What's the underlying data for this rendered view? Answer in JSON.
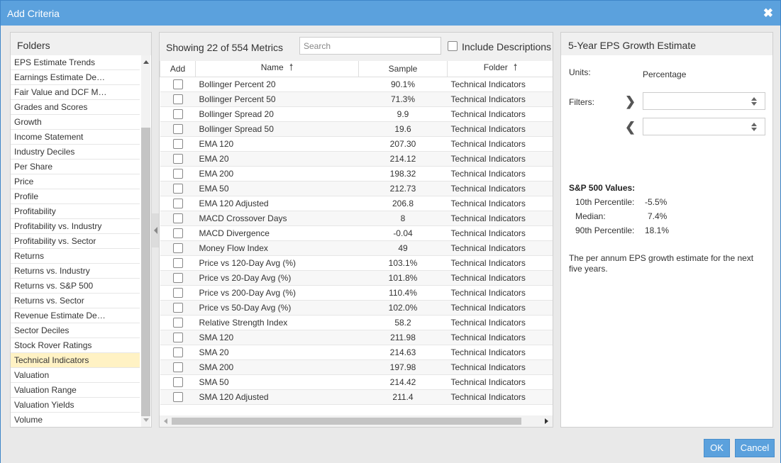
{
  "dialog": {
    "title": "Add Criteria",
    "close_icon": "close-icon"
  },
  "folders": {
    "header": "Folders",
    "items": [
      "EPS Estimate Trends",
      "Earnings Estimate De…",
      "Fair Value and DCF M…",
      "Grades and Scores",
      "Growth",
      "Income Statement",
      "Industry Deciles",
      "Per Share",
      "Price",
      "Profile",
      "Profitability",
      "Profitability vs. Industry",
      "Profitability vs. Sector",
      "Returns",
      "Returns vs. Industry",
      "Returns vs. S&P 500",
      "Returns vs. Sector",
      "Revenue Estimate De…",
      "Sector Deciles",
      "Stock Rover Ratings",
      "Technical Indicators",
      "Valuation",
      "Valuation Range",
      "Valuation Yields",
      "Volume"
    ],
    "selected": "Technical Indicators"
  },
  "metrics": {
    "showing": "Showing 22 of 554 Metrics",
    "search_placeholder": "Search",
    "include_descriptions": "Include Descriptions",
    "columns": {
      "add": "Add",
      "name": "Name",
      "sample": "Sample",
      "folder": "Folder"
    },
    "rows": [
      {
        "name": "Bollinger Percent 20",
        "sample": "90.1%",
        "folder": "Technical Indicators"
      },
      {
        "name": "Bollinger Percent 50",
        "sample": "71.3%",
        "folder": "Technical Indicators"
      },
      {
        "name": "Bollinger Spread 20",
        "sample": "9.9",
        "folder": "Technical Indicators"
      },
      {
        "name": "Bollinger Spread 50",
        "sample": "19.6",
        "folder": "Technical Indicators"
      },
      {
        "name": "EMA 120",
        "sample": "207.30",
        "folder": "Technical Indicators"
      },
      {
        "name": "EMA 20",
        "sample": "214.12",
        "folder": "Technical Indicators"
      },
      {
        "name": "EMA 200",
        "sample": "198.32",
        "folder": "Technical Indicators"
      },
      {
        "name": "EMA 50",
        "sample": "212.73",
        "folder": "Technical Indicators"
      },
      {
        "name": "EMA 120 Adjusted",
        "sample": "206.8",
        "folder": "Technical Indicators"
      },
      {
        "name": "MACD Crossover Days",
        "sample": "8",
        "folder": "Technical Indicators"
      },
      {
        "name": "MACD Divergence",
        "sample": "-0.04",
        "folder": "Technical Indicators"
      },
      {
        "name": "Money Flow Index",
        "sample": "49",
        "folder": "Technical Indicators"
      },
      {
        "name": "Price vs 120-Day Avg (%)",
        "sample": "103.1%",
        "folder": "Technical Indicators"
      },
      {
        "name": "Price vs 20-Day Avg (%)",
        "sample": "101.8%",
        "folder": "Technical Indicators"
      },
      {
        "name": "Price vs 200-Day Avg (%)",
        "sample": "110.4%",
        "folder": "Technical Indicators"
      },
      {
        "name": "Price vs 50-Day Avg (%)",
        "sample": "102.0%",
        "folder": "Technical Indicators"
      },
      {
        "name": "Relative Strength Index",
        "sample": "58.2",
        "folder": "Technical Indicators"
      },
      {
        "name": "SMA 120",
        "sample": "211.98",
        "folder": "Technical Indicators"
      },
      {
        "name": "SMA 20",
        "sample": "214.63",
        "folder": "Technical Indicators"
      },
      {
        "name": "SMA 200",
        "sample": "197.98",
        "folder": "Technical Indicators"
      },
      {
        "name": "SMA 50",
        "sample": "214.42",
        "folder": "Technical Indicators"
      },
      {
        "name": "SMA 120 Adjusted",
        "sample": "211.4",
        "folder": "Technical Indicators"
      }
    ]
  },
  "detail": {
    "title": "5-Year EPS Growth Estimate",
    "units_label": "Units:",
    "units_value": "Percentage",
    "filters_label": "Filters:",
    "sp_title": "S&P 500 Values:",
    "p10_label": "10th Percentile:",
    "p10_value": "-5.5%",
    "median_label": "Median:",
    "median_value": "7.4%",
    "p90_label": "90th Percentile:",
    "p90_value": "18.1%",
    "description": "The per annum EPS growth estimate for the next five years."
  },
  "footer": {
    "ok": "OK",
    "cancel": "Cancel"
  },
  "colors": {
    "accent": "#5ba1dd",
    "selected_row": "#fff2c4"
  }
}
